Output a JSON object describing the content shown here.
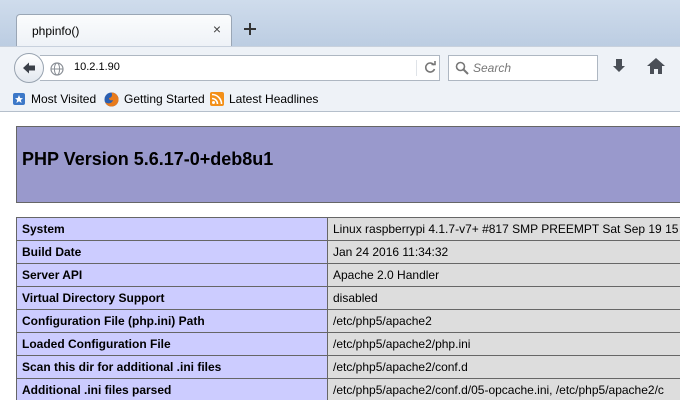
{
  "browser": {
    "tab": {
      "title": "phpinfo()"
    },
    "address": {
      "url": "10.2.1.90"
    },
    "search": {
      "placeholder": "Search"
    },
    "bookmarks": [
      {
        "label": "Most Visited",
        "icon": "bookmarks-star-icon"
      },
      {
        "label": "Getting Started",
        "icon": "firefox-icon"
      },
      {
        "label": "Latest Headlines",
        "icon": "rss-icon"
      }
    ]
  },
  "page": {
    "title": "PHP Version 5.6.17-0+deb8u1",
    "colors": {
      "header": "#9999cc",
      "key_cell": "#ccccff",
      "value_cell": "#dddddd"
    },
    "rows": [
      {
        "key": "System",
        "value": "Linux raspberrypi 4.1.7-v7+ #817 SMP PREEMPT Sat Sep 19 15"
      },
      {
        "key": "Build Date",
        "value": "Jan 24 2016 11:34:32"
      },
      {
        "key": "Server API",
        "value": "Apache 2.0 Handler"
      },
      {
        "key": "Virtual Directory Support",
        "value": "disabled"
      },
      {
        "key": "Configuration File (php.ini) Path",
        "value": "/etc/php5/apache2"
      },
      {
        "key": "Loaded Configuration File",
        "value": "/etc/php5/apache2/php.ini"
      },
      {
        "key": "Scan this dir for additional .ini files",
        "value": "/etc/php5/apache2/conf.d"
      },
      {
        "key": "Additional .ini files parsed",
        "value": "/etc/php5/apache2/conf.d/05-opcache.ini, /etc/php5/apache2/c"
      }
    ]
  }
}
